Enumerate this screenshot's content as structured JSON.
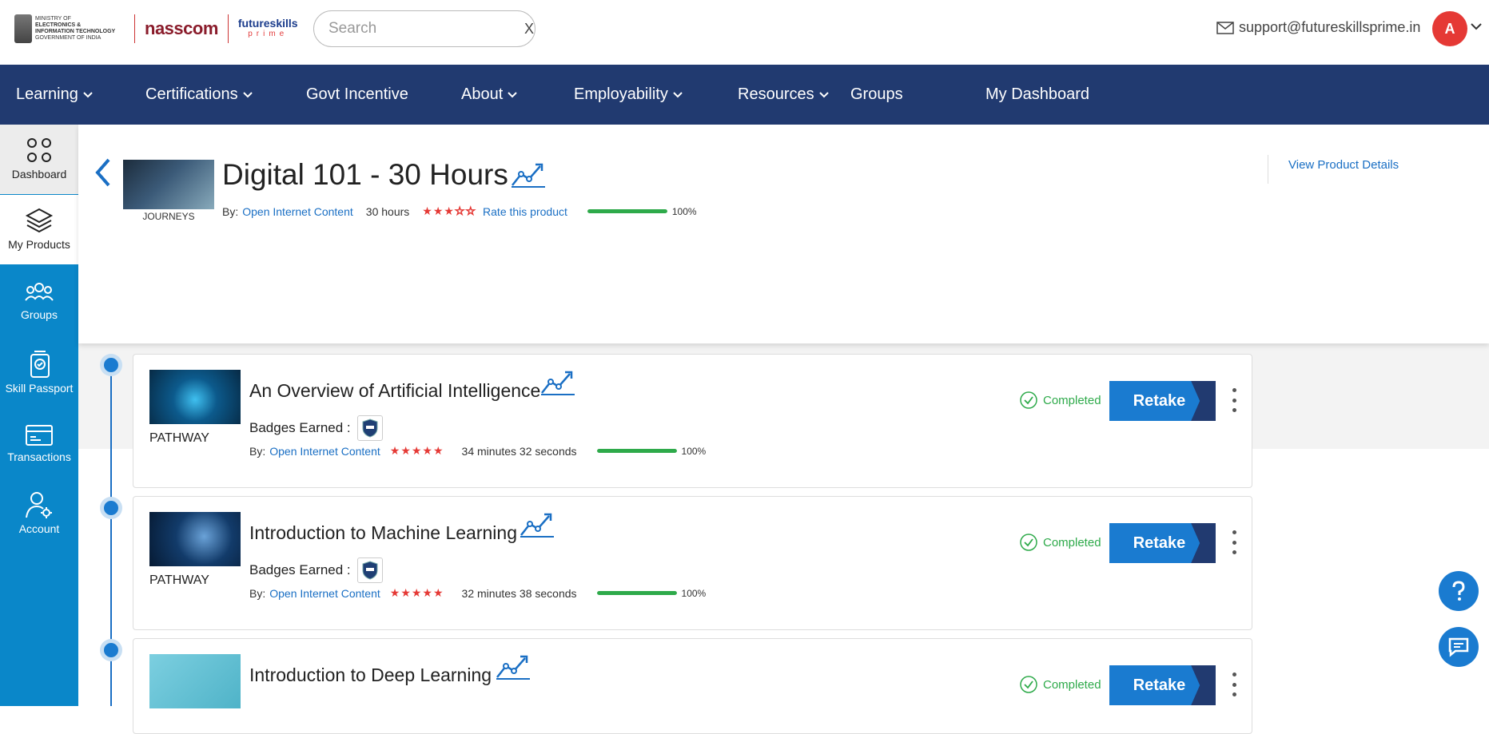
{
  "header": {
    "ministry_line1": "MINISTRY OF",
    "ministry_line2": "ELECTRONICS &",
    "ministry_line3": "INFORMATION TECHNOLOGY",
    "ministry_line4": "GOVERNMENT OF INDIA",
    "nasscom": "nasscom",
    "futureskills": "futureskills",
    "prime": "prime",
    "search_placeholder": "Search",
    "search_clear": "X",
    "support_email": "support@futureskillsprime.in",
    "avatar_initial": "A"
  },
  "nav": {
    "items": [
      "Learning",
      "Certifications",
      "Govt Incentive",
      "About",
      "Employability",
      "Resources",
      "Groups",
      "My Dashboard"
    ]
  },
  "sidebar": {
    "items": [
      "Dashboard",
      "My Products",
      "Groups",
      "Skill Passport",
      "Transactions",
      "Account"
    ]
  },
  "product": {
    "thumb_label": "JOURNEYS",
    "title": "Digital 101 - 30 Hours",
    "by_label": "By:",
    "provider": "Open Internet Content",
    "duration": "30 hours",
    "rating": 3,
    "rate_link": "Rate this product",
    "progress": 100,
    "progress_label": "100%",
    "view_details": "View Product Details"
  },
  "modules": [
    {
      "thumb_label": "PATHWAY",
      "title": "An Overview of Artificial Intelligence",
      "badges_label": "Badges Earned :",
      "by_label": "By:",
      "provider": "Open Internet Content",
      "rating": 5,
      "duration": "34 minutes 32 seconds",
      "progress": 100,
      "progress_label": "100%",
      "status": "Completed",
      "action": "Retake"
    },
    {
      "thumb_label": "PATHWAY",
      "title": "Introduction to Machine Learning",
      "badges_label": "Badges Earned :",
      "by_label": "By:",
      "provider": "Open Internet Content",
      "rating": 5,
      "duration": "32 minutes 38 seconds",
      "progress": 100,
      "progress_label": "100%",
      "status": "Completed",
      "action": "Retake"
    },
    {
      "title": "Introduction to Deep Learning",
      "status": "Completed",
      "action": "Retake"
    }
  ],
  "colors": {
    "nav_bg": "#213a70",
    "sidebar_bg": "#0a87c9",
    "accent": "#1a7bd0",
    "success": "#2eaa4a",
    "star": "#e53935"
  }
}
